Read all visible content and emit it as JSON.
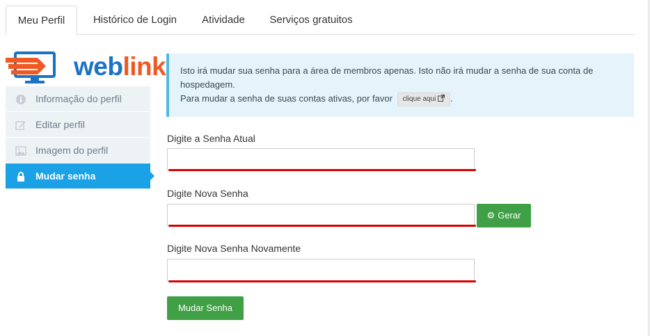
{
  "tabs": [
    {
      "label": "Meu Perfil",
      "active": true
    },
    {
      "label": "Histórico de Login",
      "active": false
    },
    {
      "label": "Atividade",
      "active": false
    },
    {
      "label": "Serviços gratuitos",
      "active": false
    }
  ],
  "logo": {
    "part1": "web",
    "part2": "link",
    "part3": "",
    "brand_blue": "#1a73c5",
    "brand_orange": "#ef5a24"
  },
  "sidebar": {
    "items": [
      {
        "label": "Informação do perfil",
        "icon": "info-icon"
      },
      {
        "label": "Editar perfil",
        "icon": "edit-icon"
      },
      {
        "label": "Imagem do perfil",
        "icon": "image-icon"
      },
      {
        "label": "Mudar senha",
        "icon": "lock-icon",
        "active": true
      }
    ]
  },
  "alert": {
    "line1": "Isto irá mudar sua senha para a área de membros apenas. Isto não irá mudar a senha de sua conta de hospedagem.",
    "line2_prefix": "Para mudar a senha de suas contas ativas, por favor",
    "link_label": "clique aqui",
    "line2_suffix": "."
  },
  "form": {
    "current_label": "Digite a Senha Atual",
    "current_value": "",
    "new_label": "Digite Nova Senha",
    "new_value": "",
    "confirm_label": "Digite Nova Senha Novamente",
    "confirm_value": "",
    "generate_label": "Gerar",
    "submit_label": "Mudar Senha"
  },
  "colors": {
    "accent": "#1aa1e6",
    "success": "#40a045",
    "annotation_red": "#d90000"
  }
}
